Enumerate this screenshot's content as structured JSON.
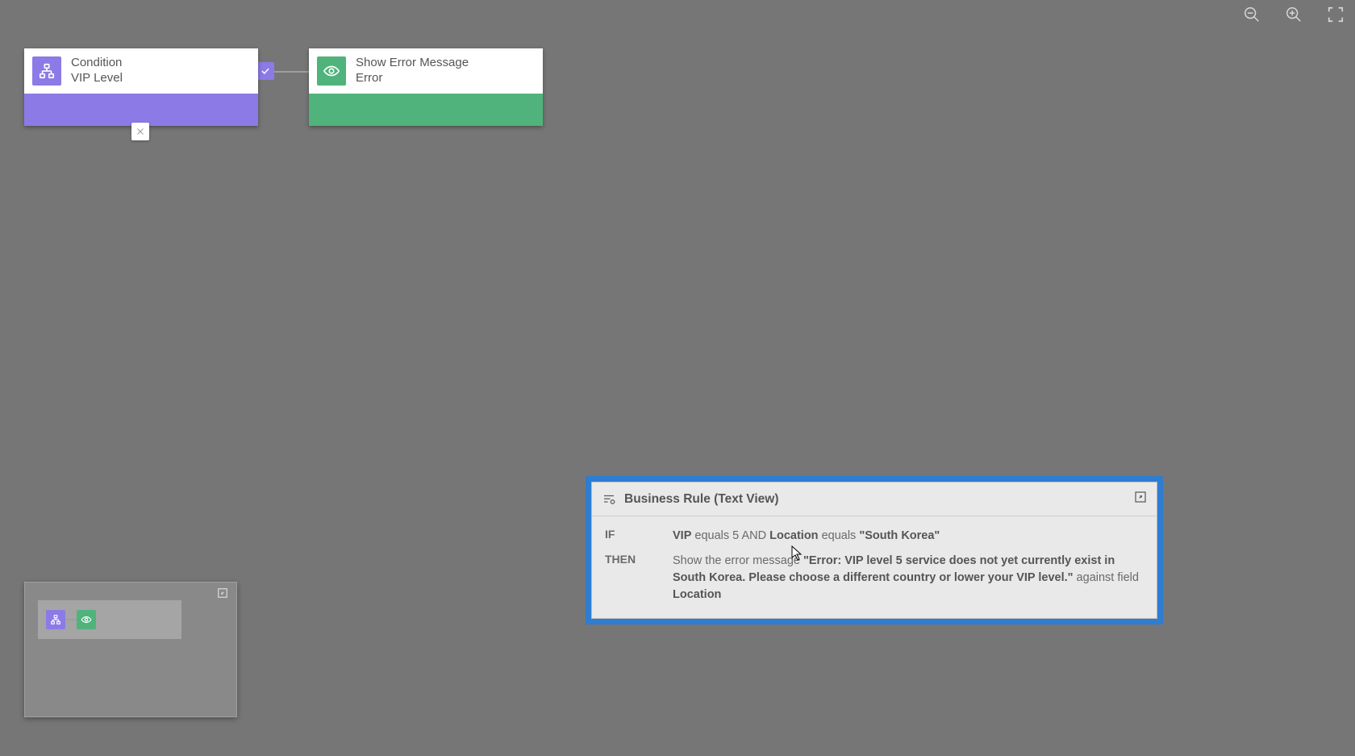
{
  "toolbar": {
    "zoom_out": "Zoom out",
    "zoom_in": "Zoom in",
    "fit": "Fit to screen"
  },
  "nodes": {
    "condition": {
      "line1": "Condition",
      "line2": "VIP Level"
    },
    "action": {
      "line1": "Show Error Message",
      "line2": "Error"
    }
  },
  "textview": {
    "title": "Business Rule (Text View)",
    "if_kw": "IF",
    "then_kw": "THEN",
    "if_expr_parts": {
      "field1": "VIP",
      "op1": " equals ",
      "val1": "5",
      "and": " AND ",
      "field2": "Location",
      "op2": " equals ",
      "val2": "\"South Korea\""
    },
    "then_expr_parts": {
      "lead": "Show the error message ",
      "msg": "\"Error: VIP level 5 service does not yet currently exist in South Korea. Please choose a different country or lower your VIP level.\"",
      "tail": " against field ",
      "field": "Location"
    }
  }
}
